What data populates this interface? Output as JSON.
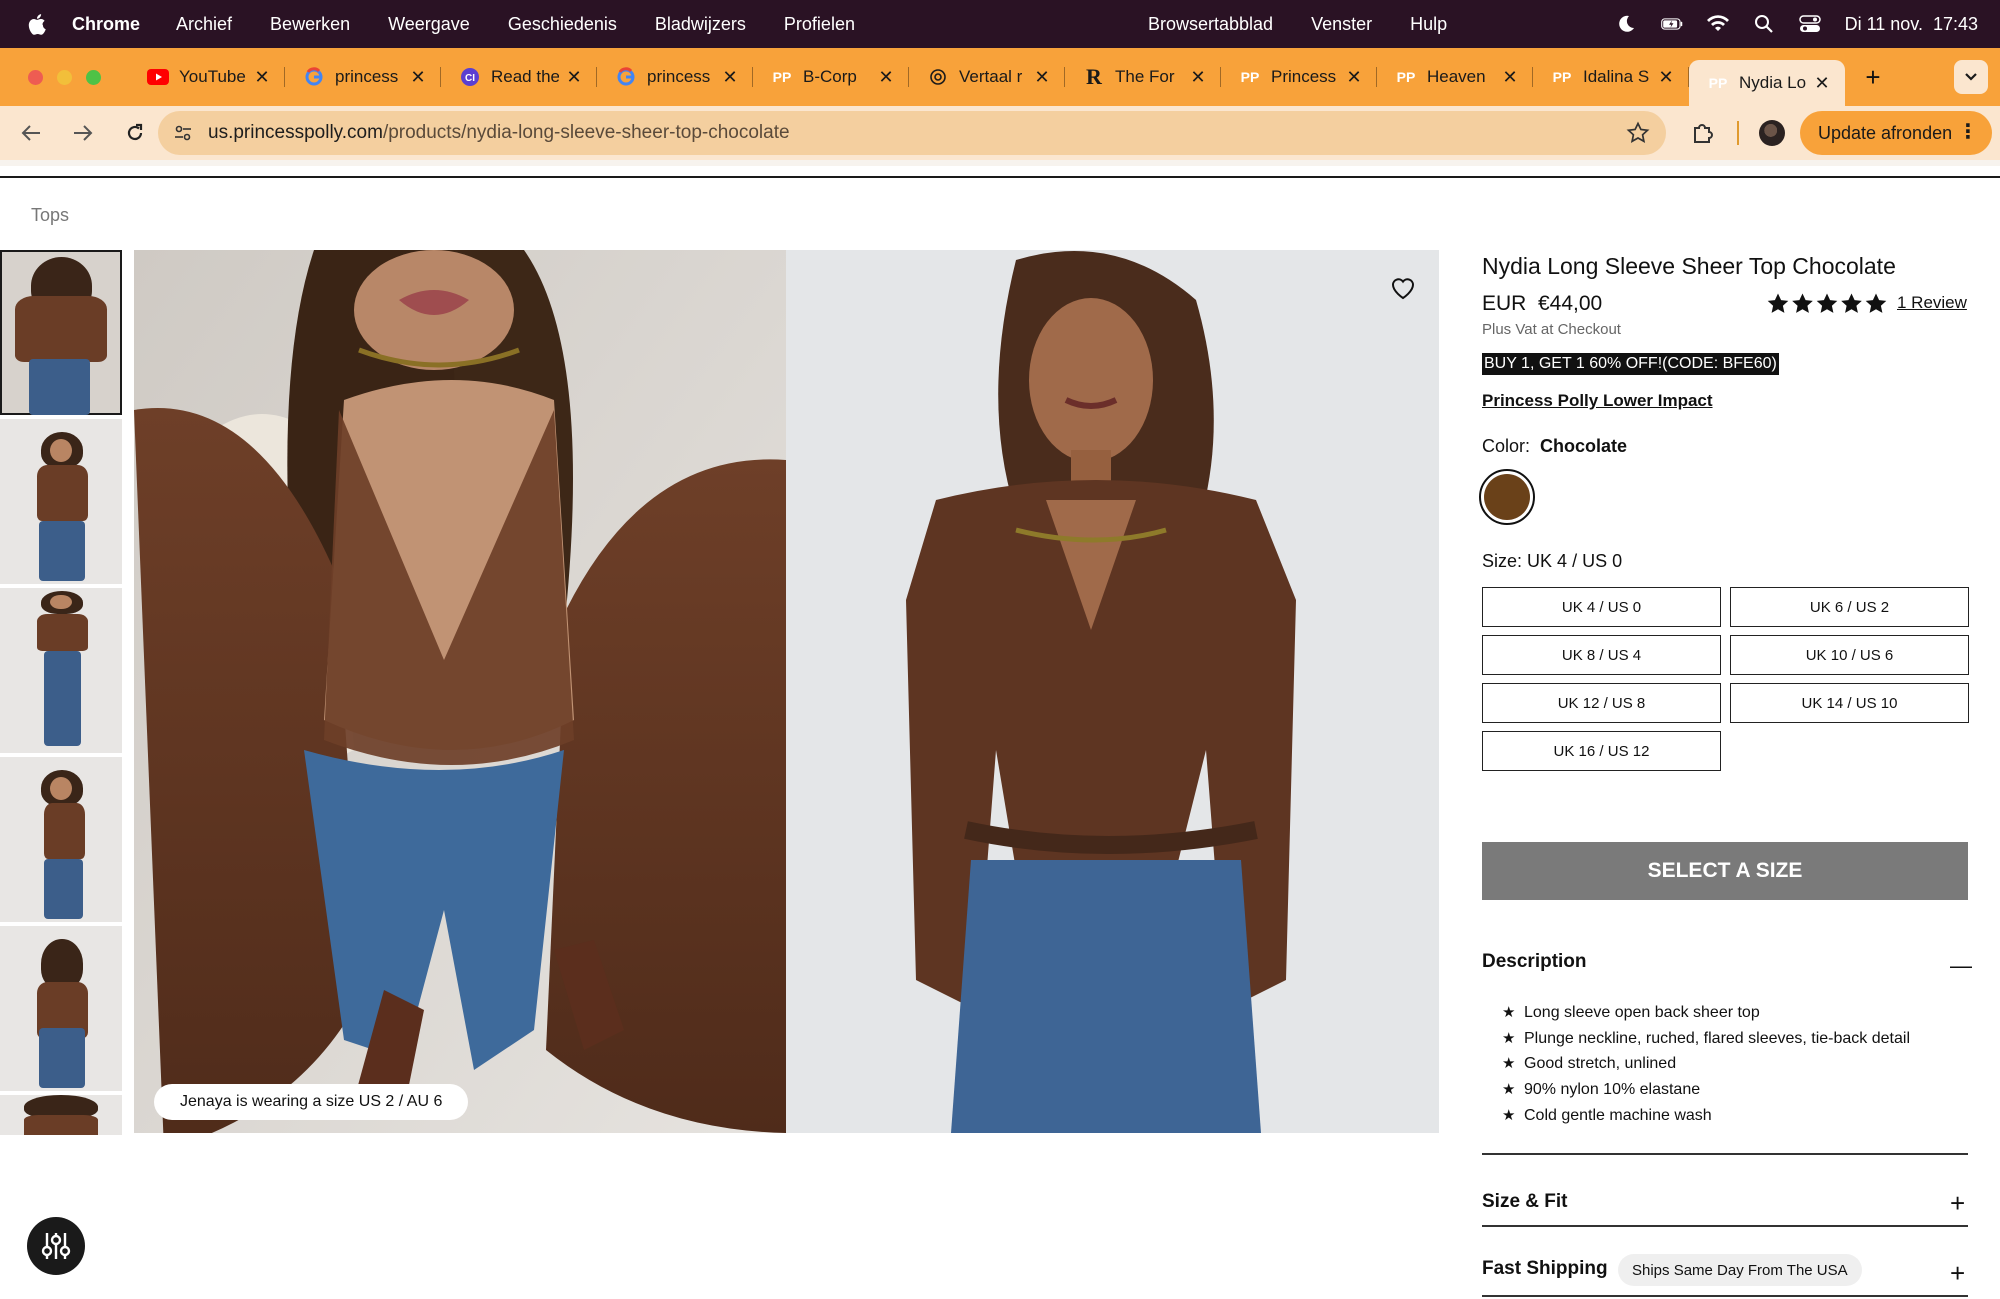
{
  "menubar": {
    "app_name": "Chrome",
    "items": [
      "Archief",
      "Bewerken",
      "Weergave",
      "Geschiedenis",
      "Bladwijzers",
      "Profielen"
    ],
    "center_items": [
      "Browsertabblad",
      "Venster",
      "Hulp"
    ],
    "datetime": "Di 11 nov.  17:43"
  },
  "tabs": [
    {
      "label": "YouTube",
      "icon": "youtube-icon"
    },
    {
      "label": "princess",
      "icon": "google-icon"
    },
    {
      "label": "Read the",
      "icon": "ai-icon"
    },
    {
      "label": "princess",
      "icon": "google-icon"
    },
    {
      "label": "B-Corp",
      "icon": "pp-icon"
    },
    {
      "label": "Vertaal r",
      "icon": "openai-icon"
    },
    {
      "label": "The For",
      "icon": "r-icon"
    },
    {
      "label": "Princess",
      "icon": "pp-icon"
    },
    {
      "label": "Heaven",
      "icon": "pp-icon"
    },
    {
      "label": "Idalina S",
      "icon": "pp-icon"
    },
    {
      "label": "Nydia Lo",
      "icon": "pp-icon",
      "active": true
    }
  ],
  "address": {
    "host": "us.princesspolly.com",
    "path": "/products/nydia-long-sleeve-sheer-top-chocolate",
    "update_label": "Update afronden"
  },
  "breadcrumb": "Tops",
  "gallery": {
    "model_note": "Jenaya is wearing a size US 2 / AU 6"
  },
  "product": {
    "title": "Nydia Long Sleeve Sheer Top Chocolate",
    "price": "EUR  €44,00",
    "rating": 5,
    "reviews": "1 Review",
    "vat_note": "Plus Vat at Checkout",
    "promo": "BUY 1, GET 1 60% OFF!(CODE: BFE60)",
    "impact_link": "Princess Polly Lower Impact",
    "color_prefix": "Color:",
    "color_name": "Chocolate",
    "color_hex": "#6a4119",
    "size_prefix": "Size:",
    "selected_size": "UK 4 / US 0",
    "sizes": [
      "UK 4 / US 0",
      "UK 6 / US 2",
      "UK 8 / US 4",
      "UK 10 / US 6",
      "UK 12 / US 8",
      "UK 14 / US 10",
      "UK 16 / US 12"
    ],
    "cta": "SELECT A SIZE",
    "description_title": "Description",
    "description_items": [
      "Long sleeve open back sheer top",
      "Plunge neckline, ruched, flared sleeves, tie-back detail",
      "Good stretch, unlined",
      "90% nylon 10% elastane",
      "Cold gentle machine wash"
    ],
    "size_fit_title": "Size & Fit",
    "shipping_title": "Fast Shipping",
    "shipping_badge": "Ships Same Day From The USA"
  },
  "colors": {
    "menubar": "#2a1224",
    "tabbar": "#f8a23a",
    "toolbar": "#fbe6cf",
    "cta_disabled": "#7a7a7a"
  }
}
